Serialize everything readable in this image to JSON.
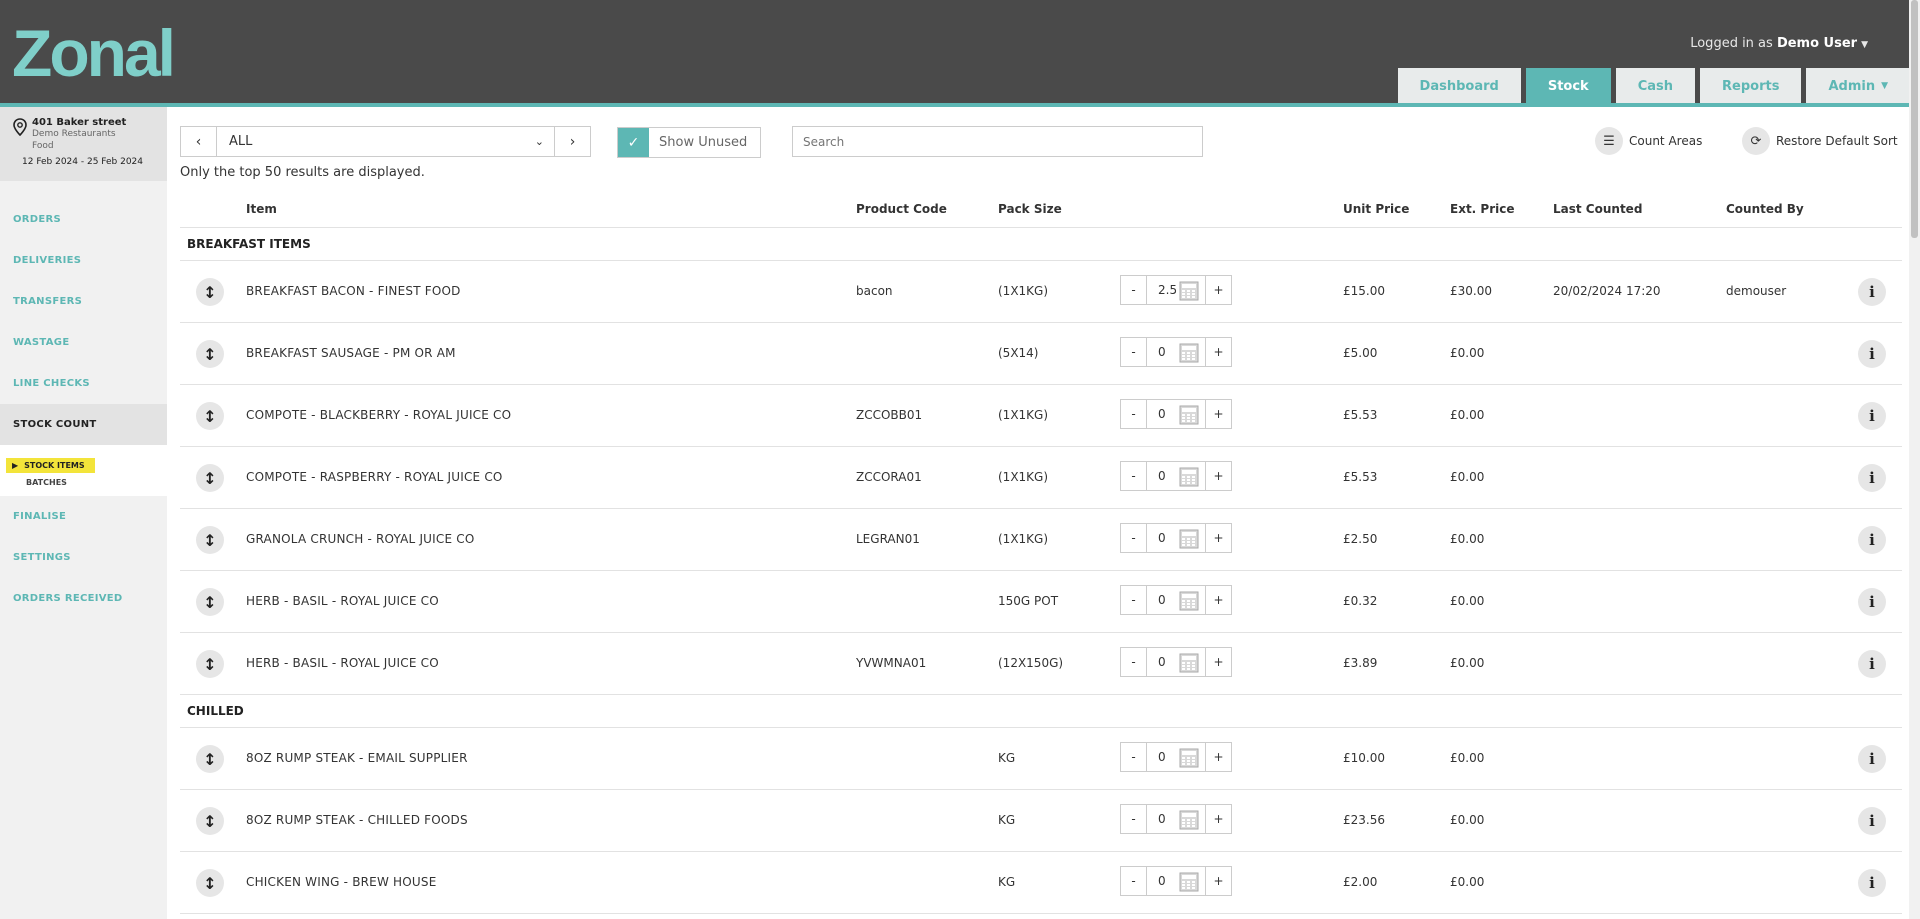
{
  "header": {
    "logo_text": "Zonal",
    "logged_in_prefix": "Logged in as",
    "user_name": "Demo User",
    "tabs": [
      {
        "label": "Dashboard"
      },
      {
        "label": "Stock"
      },
      {
        "label": "Cash"
      },
      {
        "label": "Reports"
      },
      {
        "label": "Admin"
      }
    ],
    "active_tab": "Stock"
  },
  "sidebar": {
    "site_name": "401 Baker street",
    "site_sub1": "Demo Restaurants",
    "site_sub2": "Food",
    "date_range": "12 Feb 2024 - 25 Feb 2024",
    "items": [
      {
        "label": "ORDERS"
      },
      {
        "label": "DELIVERIES"
      },
      {
        "label": "TRANSFERS"
      },
      {
        "label": "WASTAGE"
      },
      {
        "label": "LINE CHECKS"
      },
      {
        "label": "STOCK COUNT"
      },
      {
        "label": "FINALISE"
      },
      {
        "label": "SETTINGS"
      },
      {
        "label": "ORDERS RECEIVED"
      }
    ],
    "sub_items": [
      {
        "label": "STOCK ITEMS"
      },
      {
        "label": "BATCHES"
      }
    ]
  },
  "toolbar": {
    "filter_value": "ALL",
    "show_unused_label": "Show Unused",
    "search_placeholder": "Search",
    "count_areas_label": "Count Areas",
    "restore_sort_label": "Restore Default Sort",
    "note": "Only the top 50 results are displayed."
  },
  "table": {
    "headers": {
      "item": "Item",
      "code": "Product Code",
      "pack": "Pack Size",
      "unit": "Unit Price",
      "ext": "Ext. Price",
      "last": "Last Counted",
      "by": "Counted By"
    },
    "groups": [
      {
        "name": "BREAKFAST ITEMS",
        "rows": [
          {
            "item": "BREAKFAST BACON - FINEST FOOD",
            "code": "bacon",
            "pack": "(1X1KG)",
            "qty": "2.5",
            "unit": "£15.00",
            "ext": "£30.00",
            "last": "20/02/2024 17:20",
            "by": "demouser"
          },
          {
            "item": "BREAKFAST SAUSAGE - PM OR AM",
            "code": "",
            "pack": "(5X14)",
            "qty": "0",
            "unit": "£5.00",
            "ext": "£0.00",
            "last": "",
            "by": ""
          },
          {
            "item": "COMPOTE - BLACKBERRY - ROYAL JUICE CO",
            "code": "ZCCOBB01",
            "pack": "(1X1KG)",
            "qty": "0",
            "unit": "£5.53",
            "ext": "£0.00",
            "last": "",
            "by": ""
          },
          {
            "item": "COMPOTE - RASPBERRY - ROYAL JUICE CO",
            "code": "ZCCORA01",
            "pack": "(1X1KG)",
            "qty": "0",
            "unit": "£5.53",
            "ext": "£0.00",
            "last": "",
            "by": ""
          },
          {
            "item": "GRANOLA CRUNCH - ROYAL JUICE CO",
            "code": "LEGRAN01",
            "pack": "(1X1KG)",
            "qty": "0",
            "unit": "£2.50",
            "ext": "£0.00",
            "last": "",
            "by": ""
          },
          {
            "item": "HERB - BASIL - ROYAL JUICE CO",
            "code": "",
            "pack": "150G POT",
            "qty": "0",
            "unit": "£0.32",
            "ext": "£0.00",
            "last": "",
            "by": ""
          },
          {
            "item": "HERB - BASIL - ROYAL JUICE CO",
            "code": "YVWMNA01",
            "pack": "(12X150G)",
            "qty": "0",
            "unit": "£3.89",
            "ext": "£0.00",
            "last": "",
            "by": ""
          }
        ]
      },
      {
        "name": "CHILLED",
        "rows": [
          {
            "item": "8OZ RUMP STEAK - EMAIL SUPPLIER",
            "code": "",
            "pack": "KG",
            "qty": "0",
            "unit": "£10.00",
            "ext": "£0.00",
            "last": "",
            "by": ""
          },
          {
            "item": "8OZ RUMP STEAK - CHILLED FOODS",
            "code": "",
            "pack": "KG",
            "qty": "0",
            "unit": "£23.56",
            "ext": "£0.00",
            "last": "",
            "by": ""
          },
          {
            "item": "CHICKEN WING - BREW HOUSE",
            "code": "",
            "pack": "KG",
            "qty": "0",
            "unit": "£2.00",
            "ext": "£0.00",
            "last": "",
            "by": ""
          }
        ]
      }
    ]
  },
  "colors": {
    "accent": "#5db7b4",
    "header_bg": "#4a4a4a",
    "highlight": "#f3e43a"
  }
}
